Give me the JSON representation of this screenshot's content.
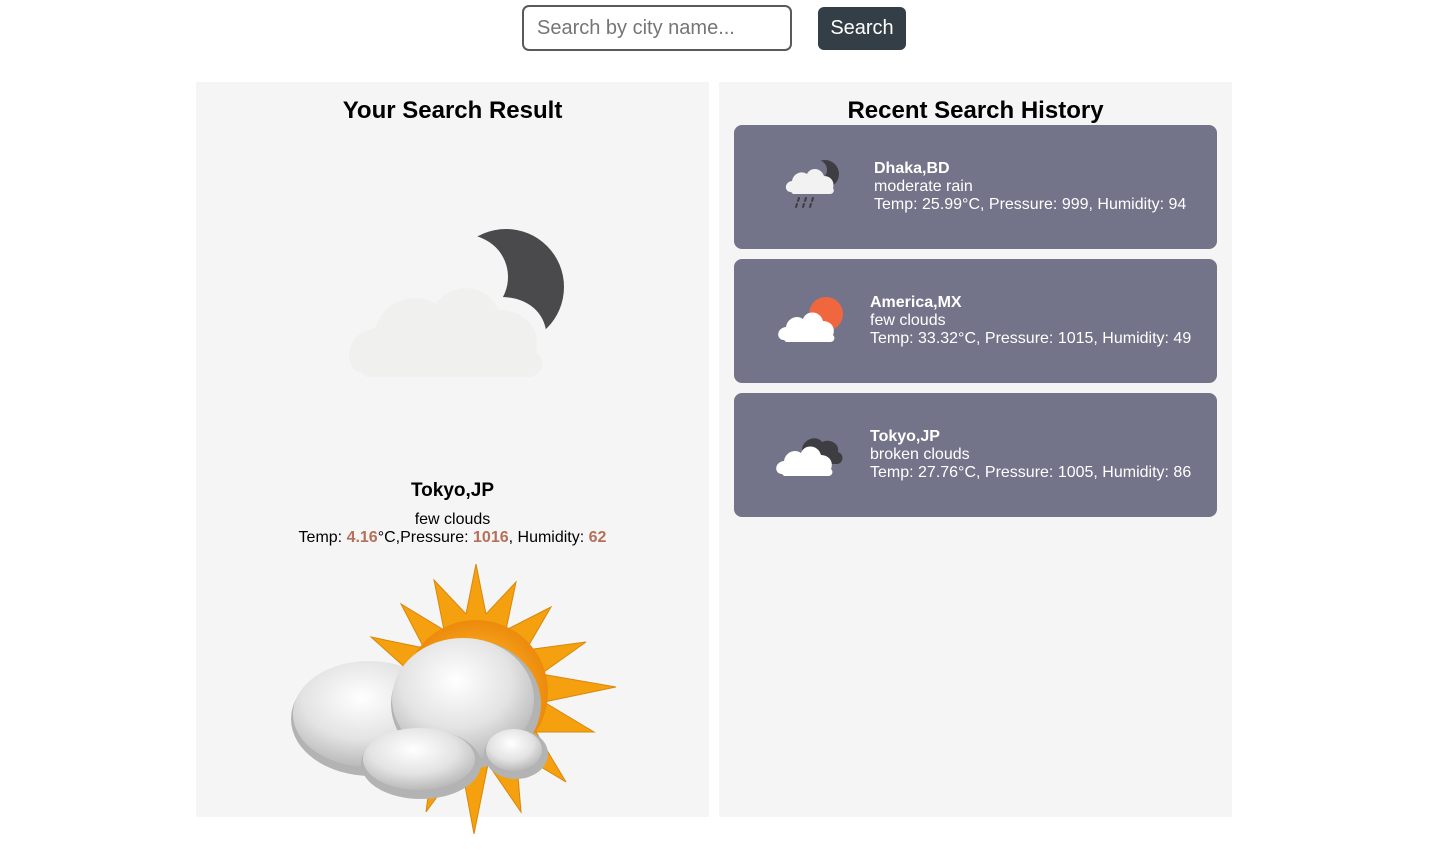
{
  "search": {
    "placeholder": "Search by city name...",
    "button_label": "Search"
  },
  "result": {
    "title": "Your Search Result",
    "city": "Tokyo,JP",
    "description": "few clouds",
    "temp_label": "Temp: ",
    "temp_value": "4.16",
    "temp_unit": "°C,",
    "pressure_label": "Pressure: ",
    "pressure_value": "1016",
    "humidity_label": ", Humidity: ",
    "humidity_value": "62",
    "icon": "night-few-clouds-icon",
    "illustration": "sun-behind-clouds-illustration"
  },
  "history": {
    "title": "Recent Search History",
    "items": [
      {
        "city": "Dhaka,BD",
        "description": "moderate rain",
        "stats": "Temp: 25.99°C, Pressure: 999, Humidity: 94",
        "icon": "night-rain-icon"
      },
      {
        "city": "America,MX",
        "description": "few clouds",
        "stats": "Temp: 33.32°C, Pressure: 1015, Humidity: 49",
        "icon": "day-few-clouds-icon"
      },
      {
        "city": "Tokyo,JP",
        "description": "broken clouds",
        "stats": "Temp: 27.76°C, Pressure: 1005, Humidity: 86",
        "icon": "broken-clouds-icon"
      }
    ]
  },
  "colors": {
    "card_bg": "#737389",
    "panel_bg": "#f5f5f5",
    "button_bg": "#343e46",
    "highlight": "#b5705a",
    "sun_orange": "#f0673f"
  }
}
